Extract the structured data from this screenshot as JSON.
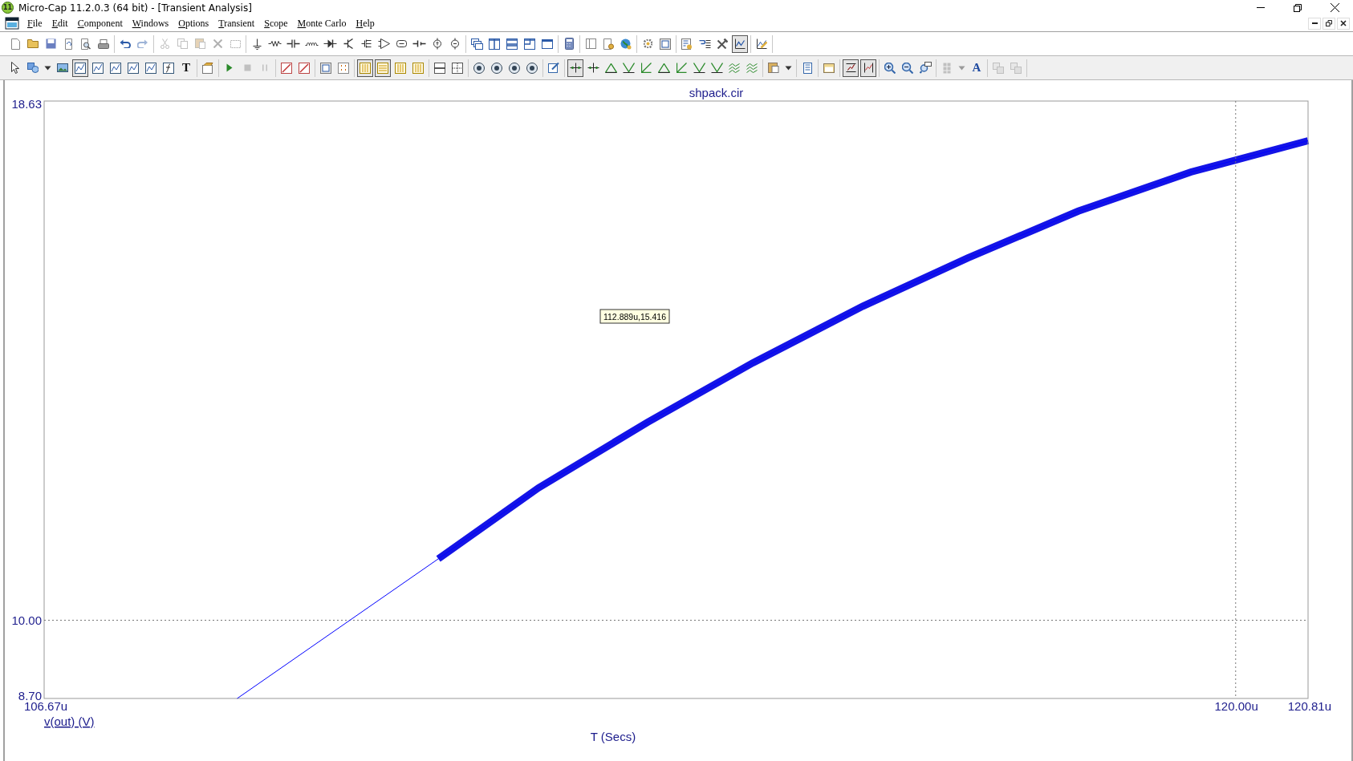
{
  "window": {
    "title": "Micro-Cap 11.2.0.3 (64 bit) - [Transient Analysis]",
    "app_badge": "11"
  },
  "menu": [
    {
      "label": "File"
    },
    {
      "label": "Edit"
    },
    {
      "label": "Component"
    },
    {
      "label": "Windows"
    },
    {
      "label": "Options"
    },
    {
      "label": "Transient"
    },
    {
      "label": "Scope"
    },
    {
      "label": "Monte Carlo"
    },
    {
      "label": "Help"
    }
  ],
  "toolbar_1": [
    [
      {
        "kind": "new",
        "pressed": false,
        "disabled": false
      },
      {
        "kind": "open",
        "pressed": false,
        "disabled": false
      },
      {
        "kind": "save",
        "pressed": false,
        "disabled": false
      },
      {
        "kind": "refresh",
        "pressed": false,
        "disabled": false
      },
      {
        "kind": "preview",
        "pressed": false,
        "disabled": false
      },
      {
        "kind": "print",
        "pressed": false,
        "disabled": false
      }
    ],
    [
      {
        "kind": "undo",
        "pressed": false,
        "disabled": false
      },
      {
        "kind": "redo",
        "pressed": false,
        "disabled": true
      }
    ],
    [
      {
        "kind": "cut",
        "pressed": false,
        "disabled": true
      },
      {
        "kind": "copy",
        "pressed": false,
        "disabled": true
      },
      {
        "kind": "paste",
        "pressed": false,
        "disabled": true
      },
      {
        "kind": "delete",
        "pressed": false,
        "disabled": true
      },
      {
        "kind": "select",
        "pressed": false,
        "disabled": true
      }
    ],
    [
      {
        "kind": "ground",
        "pressed": false,
        "disabled": false
      },
      {
        "kind": "resistor",
        "pressed": false,
        "disabled": false
      },
      {
        "kind": "capacitor",
        "pressed": false,
        "disabled": false
      },
      {
        "kind": "inductor",
        "pressed": false,
        "disabled": false
      },
      {
        "kind": "diode",
        "pressed": false,
        "disabled": false
      },
      {
        "kind": "bjt",
        "pressed": false,
        "disabled": false
      },
      {
        "kind": "mosfet",
        "pressed": false,
        "disabled": false
      },
      {
        "kind": "opamp",
        "pressed": false,
        "disabled": false
      },
      {
        "kind": "box",
        "pressed": false,
        "disabled": false
      },
      {
        "kind": "battery",
        "pressed": false,
        "disabled": false
      },
      {
        "kind": "source",
        "pressed": false,
        "disabled": false
      },
      {
        "kind": "source2",
        "pressed": false,
        "disabled": false
      }
    ],
    [
      {
        "kind": "cascade",
        "pressed": false,
        "disabled": false
      },
      {
        "kind": "tilev",
        "pressed": false,
        "disabled": false
      },
      {
        "kind": "tileh",
        "pressed": false,
        "disabled": false
      },
      {
        "kind": "tile",
        "pressed": false,
        "disabled": false
      },
      {
        "kind": "window",
        "pressed": false,
        "disabled": false
      }
    ],
    [
      {
        "kind": "calc",
        "pressed": false,
        "disabled": false
      }
    ],
    [
      {
        "kind": "panel",
        "pressed": false,
        "disabled": false
      },
      {
        "kind": "docgear",
        "pressed": false,
        "disabled": false
      },
      {
        "kind": "globe",
        "pressed": false,
        "disabled": false
      }
    ],
    [
      {
        "kind": "gear",
        "pressed": false,
        "disabled": false
      },
      {
        "kind": "frame",
        "pressed": false,
        "disabled": false
      }
    ],
    [
      {
        "kind": "listgear",
        "pressed": false,
        "disabled": false
      },
      {
        "kind": "listarrow",
        "pressed": false,
        "disabled": false
      },
      {
        "kind": "tools",
        "pressed": false,
        "disabled": false
      },
      {
        "kind": "plot",
        "pressed": true,
        "disabled": false
      }
    ],
    [
      {
        "kind": "plotedit",
        "pressed": false,
        "disabled": false
      }
    ]
  ],
  "toolbar_2": [
    [
      {
        "kind": "pointer",
        "pressed": false,
        "disabled": false
      },
      {
        "kind": "shapes",
        "pressed": false,
        "disabled": false
      },
      {
        "kind": "dropdown",
        "pressed": false,
        "disabled": false
      },
      {
        "kind": "image",
        "pressed": false,
        "disabled": false
      },
      {
        "kind": "graph",
        "pressed": true,
        "disabled": false
      },
      {
        "kind": "graph",
        "pressed": false,
        "disabled": false
      },
      {
        "kind": "graph",
        "pressed": false,
        "disabled": false
      },
      {
        "kind": "graph",
        "pressed": false,
        "disabled": false
      },
      {
        "kind": "graph",
        "pressed": false,
        "disabled": false
      },
      {
        "kind": "fx",
        "pressed": false,
        "disabled": false
      },
      {
        "kind": "text",
        "label": "T",
        "pressed": false,
        "disabled": false
      }
    ],
    [
      {
        "kind": "properties",
        "pressed": false,
        "disabled": false
      }
    ],
    [
      {
        "kind": "run",
        "pressed": false,
        "disabled": false
      },
      {
        "kind": "stop",
        "pressed": false,
        "disabled": true
      },
      {
        "kind": "pause",
        "pressed": false,
        "disabled": true
      }
    ],
    [
      {
        "kind": "redplot",
        "pressed": false,
        "disabled": false
      },
      {
        "kind": "redplot",
        "pressed": false,
        "disabled": false
      }
    ],
    [
      {
        "kind": "frame",
        "pressed": false,
        "disabled": false
      },
      {
        "kind": "dots",
        "pressed": false,
        "disabled": false
      }
    ],
    [
      {
        "kind": "bars",
        "pressed": true,
        "disabled": false
      },
      {
        "kind": "rows",
        "pressed": true,
        "disabled": false
      },
      {
        "kind": "bars",
        "pressed": false,
        "disabled": false
      },
      {
        "kind": "bars",
        "pressed": false,
        "disabled": false
      }
    ],
    [
      {
        "kind": "hline",
        "pressed": false,
        "disabled": false
      },
      {
        "kind": "crossgrid",
        "pressed": false,
        "disabled": false
      }
    ],
    [
      {
        "kind": "circle",
        "pressed": false,
        "disabled": false
      },
      {
        "kind": "circle",
        "pressed": false,
        "disabled": false
      },
      {
        "kind": "circle",
        "pressed": false,
        "disabled": false
      },
      {
        "kind": "circle",
        "pressed": false,
        "disabled": false
      }
    ],
    [
      {
        "kind": "editnote",
        "pressed": false,
        "disabled": false
      }
    ],
    [
      {
        "kind": "cursor",
        "pressed": true,
        "disabled": false
      },
      {
        "kind": "cursor",
        "pressed": false,
        "disabled": false
      },
      {
        "kind": "peak",
        "pressed": false,
        "disabled": false
      },
      {
        "kind": "valley",
        "pressed": false,
        "disabled": false
      },
      {
        "kind": "slope",
        "pressed": false,
        "disabled": false
      },
      {
        "kind": "peak",
        "pressed": false,
        "disabled": false
      },
      {
        "kind": "slope",
        "pressed": false,
        "disabled": false
      },
      {
        "kind": "valley",
        "pressed": false,
        "disabled": false
      },
      {
        "kind": "valley",
        "pressed": false,
        "disabled": false
      },
      {
        "kind": "waves",
        "pressed": false,
        "disabled": false
      },
      {
        "kind": "waves",
        "pressed": false,
        "disabled": false
      }
    ],
    [
      {
        "kind": "clipboard",
        "pressed": false,
        "disabled": false
      },
      {
        "kind": "dropdown",
        "pressed": false,
        "disabled": false
      }
    ],
    [
      {
        "kind": "notes",
        "pressed": false,
        "disabled": false
      }
    ],
    [
      {
        "kind": "calendar",
        "pressed": false,
        "disabled": false
      }
    ],
    [
      {
        "kind": "fitx",
        "pressed": true,
        "disabled": false
      },
      {
        "kind": "fity",
        "pressed": true,
        "disabled": false
      }
    ],
    [
      {
        "kind": "zoomin",
        "pressed": false,
        "disabled": false
      },
      {
        "kind": "zoomout",
        "pressed": false,
        "disabled": false
      },
      {
        "kind": "zoomfit",
        "pressed": false,
        "disabled": false
      }
    ],
    [
      {
        "kind": "tiles",
        "pressed": false,
        "disabled": true
      },
      {
        "kind": "dropdown",
        "pressed": false,
        "disabled": true
      },
      {
        "kind": "font",
        "label": "A",
        "pressed": false,
        "disabled": false
      }
    ],
    [
      {
        "kind": "stack",
        "pressed": false,
        "disabled": true
      },
      {
        "kind": "stack",
        "pressed": false,
        "disabled": true
      }
    ]
  ],
  "plot": {
    "chart_data": {
      "type": "line",
      "title": "shpack.cir",
      "xlabel": "T (Secs)",
      "x": [
        108.83,
        110.09,
        111.08,
        112.2,
        113.42,
        114.6,
        115.83,
        117.0,
        118.24,
        119.5,
        120.81
      ],
      "series": [
        {
          "name": "v(out) (V)",
          "color": "#0000ff",
          "values": [
            8.7,
            10.0,
            11.02,
            12.2,
            13.29,
            14.28,
            15.22,
            16.02,
            16.8,
            17.45,
            17.97
          ]
        }
      ],
      "xlim": [
        106.67,
        120.81
      ],
      "ylim": [
        8.7,
        18.63
      ],
      "xticks": [
        {
          "value": 106.67,
          "label": "106.67u"
        },
        {
          "value": 120.0,
          "label": "120.00u"
        },
        {
          "value": 120.81,
          "label": "120.81u"
        }
      ],
      "yticks": [
        {
          "value": 8.7,
          "label": "8.70"
        },
        {
          "value": 10.0,
          "label": "10.00"
        },
        {
          "value": 18.63,
          "label": "18.63"
        }
      ],
      "annotations": [
        "112.889u,15.416"
      ]
    }
  }
}
